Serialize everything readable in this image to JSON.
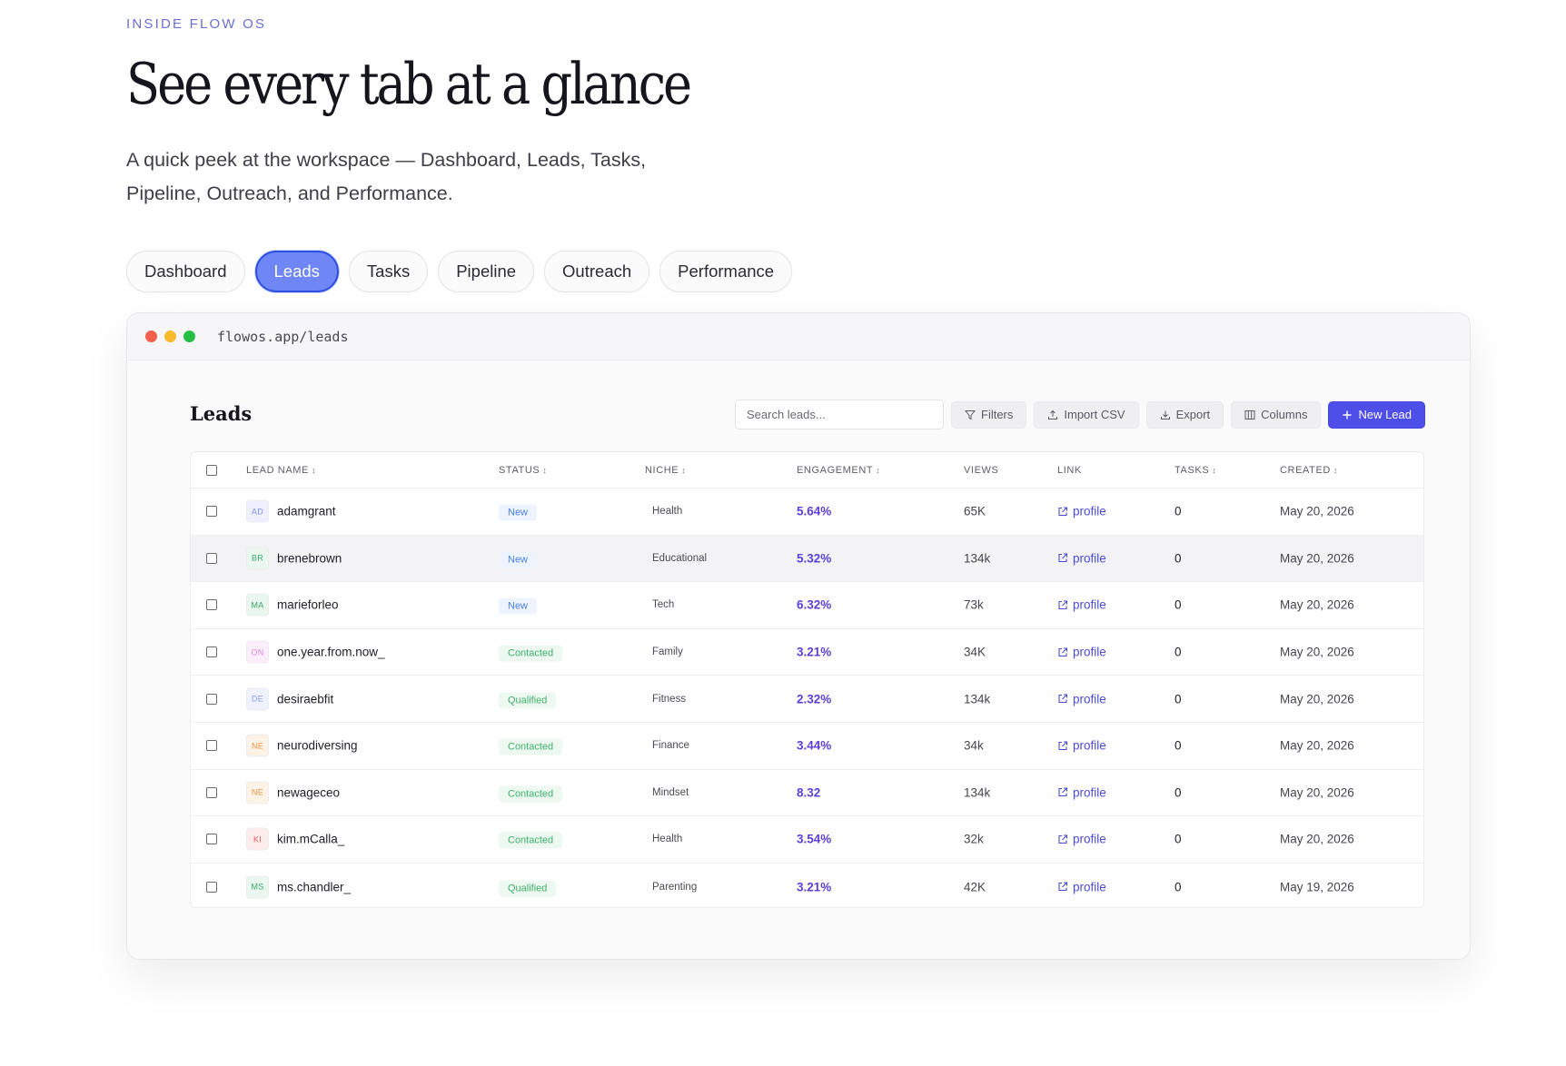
{
  "hero": {
    "eyebrow": "INSIDE FLOW OS",
    "headline": "See every tab at a glance",
    "subtitle": "A quick peek at the workspace — Dashboard, Leads, Tasks, Pipeline, Outreach, and Performance."
  },
  "tabs": [
    {
      "label": "Dashboard",
      "active": false
    },
    {
      "label": "Leads",
      "active": true
    },
    {
      "label": "Tasks",
      "active": false
    },
    {
      "label": "Pipeline",
      "active": false
    },
    {
      "label": "Outreach",
      "active": false
    },
    {
      "label": "Performance",
      "active": false
    }
  ],
  "window": {
    "url": "flowos.app/leads",
    "title": "Leads",
    "search_placeholder": "Search leads...",
    "toolbar": {
      "filters": "Filters",
      "import": "Import CSV",
      "export": "Export",
      "columns": "Columns",
      "new_lead": "New Lead"
    },
    "columns": {
      "lead_name": "LEAD NAME",
      "status": "STATUS",
      "niche": "NICHE",
      "engagement": "ENGAGEMENT",
      "views": "VIEWS",
      "link": "LINK",
      "tasks": "TASKS",
      "created": "CREATED"
    },
    "sort_glyph": "↕",
    "rows": [
      {
        "initials": "AD",
        "avatar_color": "#7e8ef0",
        "avatar_bg": "#eef1fd",
        "name": "adamgrant",
        "status": "New",
        "status_kind": "new",
        "niche": "Health",
        "engagement": "5.64%",
        "views": "65K",
        "link": "profile",
        "tasks": "0",
        "created": "May 20, 2026"
      },
      {
        "initials": "BR",
        "avatar_color": "#3aa66a",
        "avatar_bg": "#eaf7ef",
        "name": "brenebrown",
        "status": "New",
        "status_kind": "new",
        "niche": "Educational",
        "engagement": "5.32%",
        "views": "134k",
        "link": "profile",
        "tasks": "0",
        "created": "May 20, 2026"
      },
      {
        "initials": "MA",
        "avatar_color": "#3aa66a",
        "avatar_bg": "#eaf7ef",
        "name": "marieforleo",
        "status": "New",
        "status_kind": "new",
        "niche": "Tech",
        "engagement": "6.32%",
        "views": "73k",
        "link": "profile",
        "tasks": "0",
        "created": "May 20, 2026"
      },
      {
        "initials": "ON",
        "avatar_color": "#d58ad6",
        "avatar_bg": "#fbeefb",
        "name": "one.year.from.now_",
        "status": "Contacted",
        "status_kind": "contacted",
        "niche": "Family",
        "engagement": "3.21%",
        "views": "34K",
        "link": "profile",
        "tasks": "0",
        "created": "May 20, 2026"
      },
      {
        "initials": "DE",
        "avatar_color": "#8fa0ef",
        "avatar_bg": "#eff2fd",
        "name": "desiraebfit",
        "status": "Qualified",
        "status_kind": "qualified",
        "niche": "Fitness",
        "engagement": "2.32%",
        "views": "134k",
        "link": "profile",
        "tasks": "0",
        "created": "May 20, 2026"
      },
      {
        "initials": "NE",
        "avatar_color": "#e89545",
        "avatar_bg": "#fdf2e6",
        "name": "neurodiversing",
        "status": "Contacted",
        "status_kind": "contacted",
        "niche": "Finance",
        "engagement": "3.44%",
        "views": "34k",
        "link": "profile",
        "tasks": "0",
        "created": "May 20, 2026"
      },
      {
        "initials": "NE",
        "avatar_color": "#e89545",
        "avatar_bg": "#fdf2e6",
        "name": "newageceo",
        "status": "Contacted",
        "status_kind": "contacted",
        "niche": "Mindset",
        "engagement": "8.32",
        "views": "134k",
        "link": "profile",
        "tasks": "0",
        "created": "May 20, 2026"
      },
      {
        "initials": "KI",
        "avatar_color": "#e05a5a",
        "avatar_bg": "#fdecec",
        "name": "kim.mCalla_",
        "status": "Contacted",
        "status_kind": "contacted",
        "niche": "Health",
        "engagement": "3.54%",
        "views": "32k",
        "link": "profile",
        "tasks": "0",
        "created": "May 20, 2026"
      },
      {
        "initials": "MS",
        "avatar_color": "#3aa66a",
        "avatar_bg": "#eaf7ef",
        "name": "ms.chandler_",
        "status": "Qualified",
        "status_kind": "qualified",
        "niche": "Parenting",
        "engagement": "3.21%",
        "views": "42K",
        "link": "profile",
        "tasks": "0",
        "created": "May 19, 2026"
      }
    ],
    "highlighted_row": 1
  },
  "colors": {
    "accent": "#4e4ee8",
    "tab_active": "#6f86f7",
    "engagement": "#5b3fd9",
    "status_new_text": "#4a7fe0",
    "status_new_bg": "#eef4fd",
    "status_green_text": "#3fb06b",
    "status_green_bg": "#ecf8f0"
  }
}
